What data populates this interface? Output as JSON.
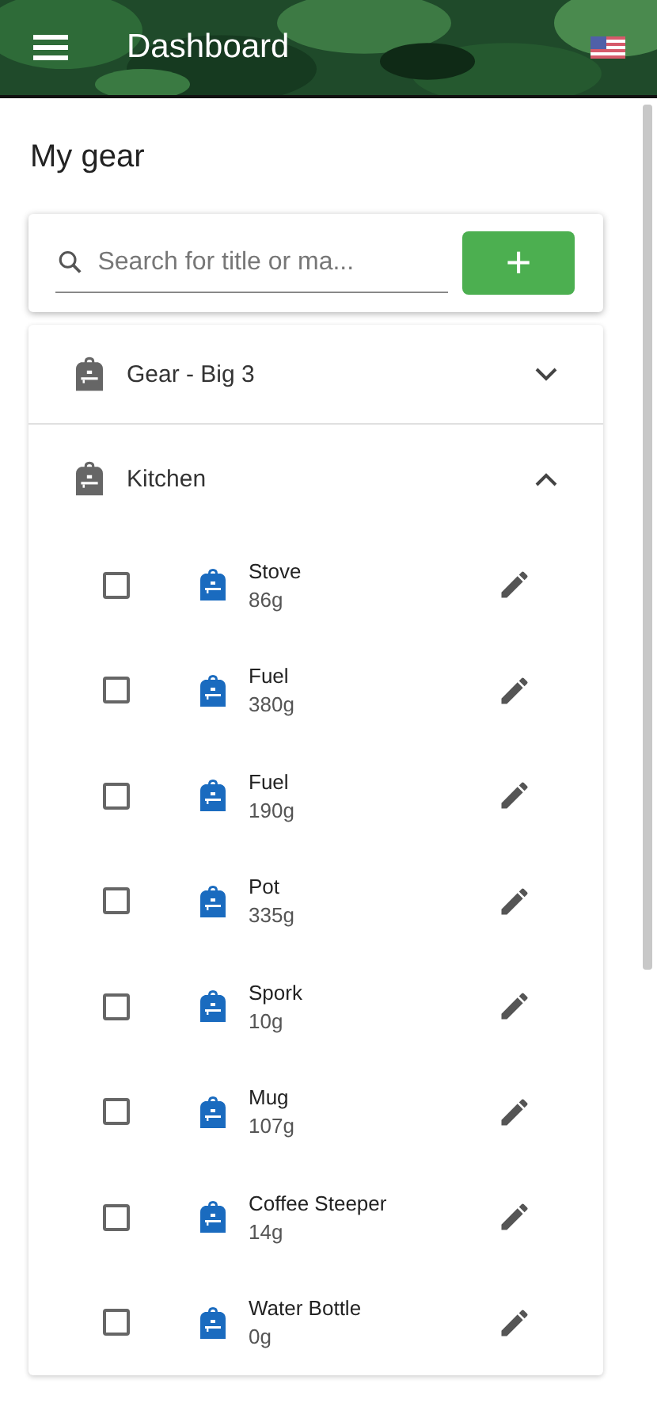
{
  "header": {
    "title": "Dashboard"
  },
  "page_title": "My gear",
  "search": {
    "placeholder": "Search for title or ma..."
  },
  "add_button": {
    "label": "+"
  },
  "groups": [
    {
      "name": "Gear - Big 3",
      "expanded": false
    },
    {
      "name": "Kitchen",
      "expanded": true,
      "items": [
        {
          "name": "Stove",
          "weight": "86g",
          "checked": false
        },
        {
          "name": "Fuel",
          "weight": "380g",
          "checked": false
        },
        {
          "name": "Fuel",
          "weight": "190g",
          "checked": false
        },
        {
          "name": "Pot",
          "weight": "335g",
          "checked": false
        },
        {
          "name": "Spork",
          "weight": "10g",
          "checked": false
        },
        {
          "name": "Mug",
          "weight": "107g",
          "checked": false
        },
        {
          "name": "Coffee Steeper",
          "weight": "14g",
          "checked": false
        },
        {
          "name": "Water Bottle",
          "weight": "0g",
          "checked": false
        }
      ]
    }
  ]
}
